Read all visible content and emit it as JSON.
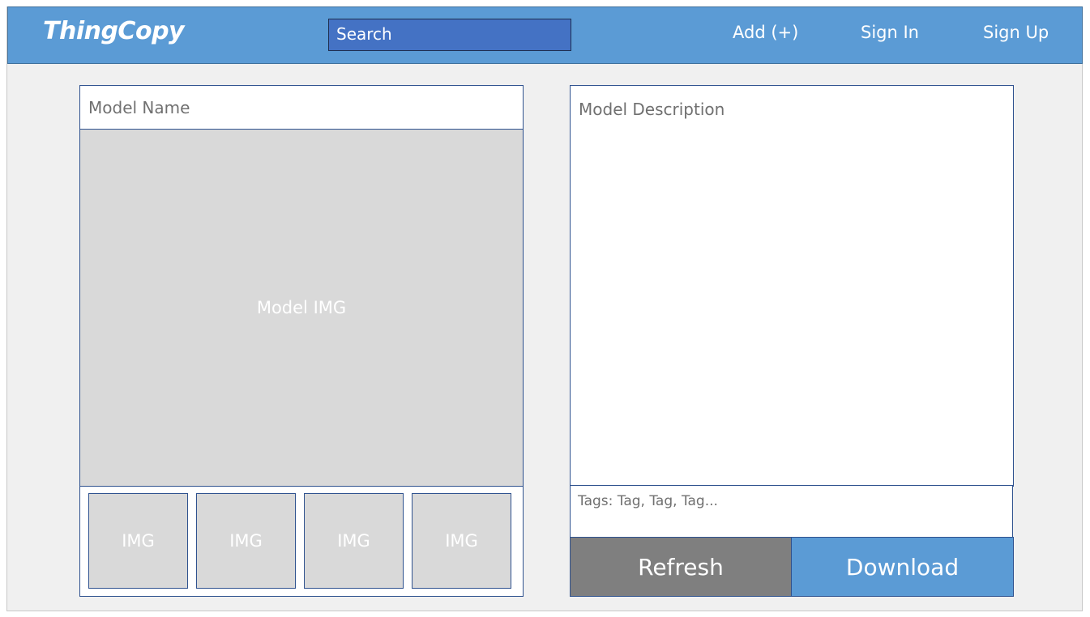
{
  "header": {
    "logo": "ThingCopy",
    "search_placeholder": "Search",
    "nav": {
      "add": "Add (+)",
      "sign_in": "Sign In",
      "sign_up": "Sign Up"
    }
  },
  "model": {
    "name_placeholder": "Model Name",
    "main_image_label": "Model IMG",
    "thumbnails": [
      "IMG",
      "IMG",
      "IMG",
      "IMG"
    ],
    "description_placeholder": "Model Description",
    "tags_text": "Tags: Tag, Tag, Tag..."
  },
  "actions": {
    "refresh": "Refresh",
    "download": "Download"
  },
  "colors": {
    "header_bg": "#5b9bd5",
    "search_bg": "#4472c4",
    "refresh_bg": "#7f7f7f",
    "download_bg": "#5b9bd5",
    "image_placeholder": "#d9d9d9",
    "border": "#2f528f"
  }
}
